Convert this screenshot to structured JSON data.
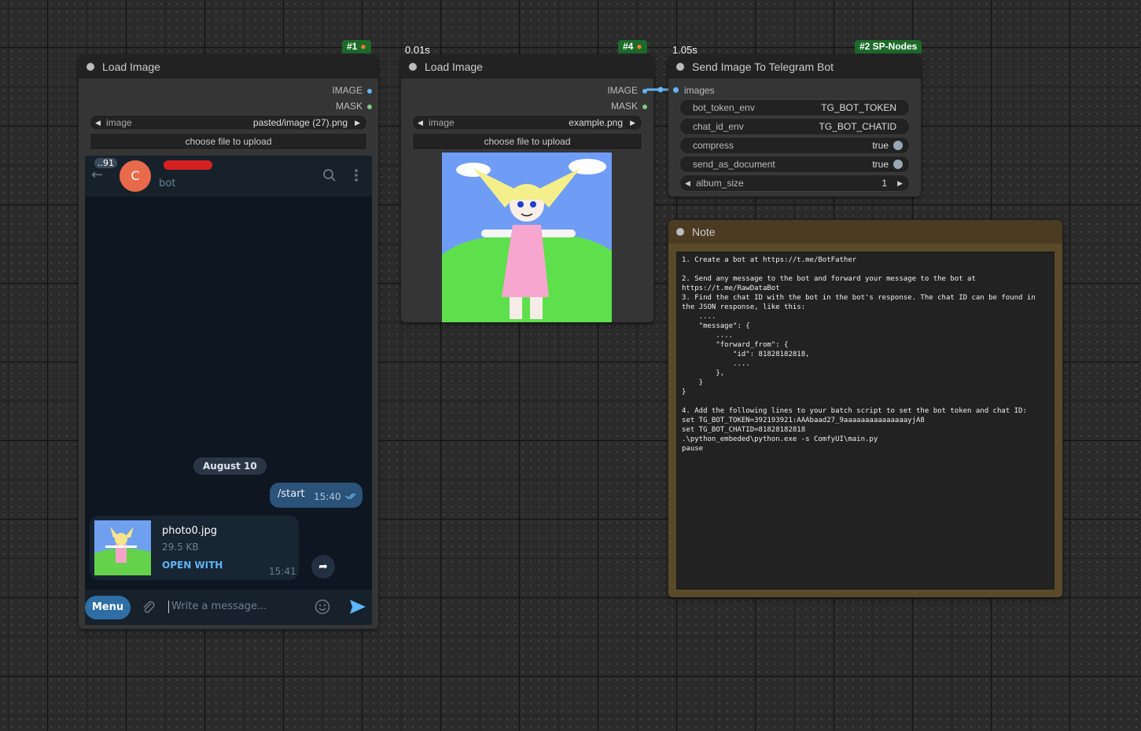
{
  "nodes": {
    "load1": {
      "badge": "#1",
      "title": "Load Image",
      "outputs": [
        "IMAGE",
        "MASK"
      ],
      "image_label": "image",
      "image_value": "pasted/image (27).png",
      "upload": "choose file to upload"
    },
    "load4": {
      "badge": "#4",
      "timing": "0.01s",
      "title": "Load Image",
      "outputs": [
        "IMAGE",
        "MASK"
      ],
      "image_label": "image",
      "image_value": "example.png",
      "upload": "choose file to upload"
    },
    "send": {
      "badge": "#2 SP-Nodes",
      "timing": "1.05s",
      "title": "Send Image To Telegram Bot",
      "input": "images",
      "widgets": [
        {
          "label": "bot_token_env",
          "value": "TG_BOT_TOKEN"
        },
        {
          "label": "chat_id_env",
          "value": "TG_BOT_CHATID"
        },
        {
          "label": "compress",
          "value": "true"
        },
        {
          "label": "send_as_document",
          "value": "true"
        },
        {
          "label": "album_size",
          "value": "1"
        }
      ]
    },
    "note": {
      "title": "Note",
      "text": "1. Create a bot at https://t.me/BotFather\n\n2. Send any message to the bot and forward your message to the bot at\nhttps://t.me/RawDataBot\n3. Find the chat ID with the bot in the bot's response. The chat ID can be found in\nthe JSON response, like this:\n    ....\n    \"message\": {\n        ....\n        \"forward_from\": {\n            \"id\": 81828182818,\n            ....\n        },\n    }\n}\n\n4. Add the following lines to your batch script to set the bot token and chat ID:\nset TG_BOT_TOKEN=392193921:AAAbaad27_9aaaaaaaaaaaaaaayjA8\nset TG_BOT_CHATID=81828182818\n.\\python_embeded\\python.exe -s ComfyUI\\main.py\npause"
    }
  },
  "telegram": {
    "unread": "..91",
    "avatar_letter": "C",
    "subtitle": "bot",
    "date": "August 10",
    "out_message": "/start",
    "out_time": "15:40",
    "file_name": "photo0.jpg",
    "file_size": "29.5 KB",
    "open_with": "OPEN WITH",
    "file_time": "15:41",
    "menu": "Menu",
    "placeholder": "Write a message..."
  },
  "colors": {
    "image_socket": "#64b5f6",
    "mask_socket": "#81c784",
    "badge_green": "#1d6b2a",
    "note_frame": "#5a4a2a"
  }
}
